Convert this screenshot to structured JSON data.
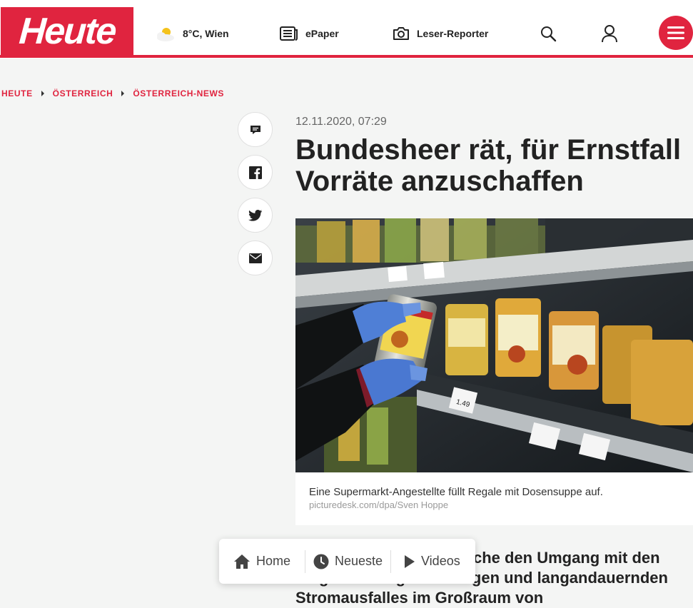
{
  "header": {
    "logo_text": "Heute",
    "weather": "8°C, Wien",
    "epaper": "ePaper",
    "reporter": "Leser-Reporter",
    "accent": "#e0243f"
  },
  "breadcrumb": [
    "HEUTE",
    "ÖSTERREICH",
    "ÖSTERREICH-NEWS"
  ],
  "share_icons": [
    "comment-icon",
    "facebook-icon",
    "twitter-icon",
    "mail-icon"
  ],
  "article": {
    "date": "12.11.2020, 07:29",
    "title_line1": "Bundesheer rät, für Ernstfall",
    "title_line2": "Vorräte anzuschaffen",
    "caption": "Eine Supermarkt-Angestellte füllt Regale mit Dosensuppe auf.",
    "credit": "picturedesk.com/dpa/Sven Hoppe",
    "lead": "… zeigt der Vortrag, welche den Umgang mit den Folgen eines großflächigen und langandauernden Stromausfalles im Großraum von"
  },
  "bottom_nav": {
    "home": "Home",
    "newest": "Neueste",
    "videos": "Videos"
  }
}
